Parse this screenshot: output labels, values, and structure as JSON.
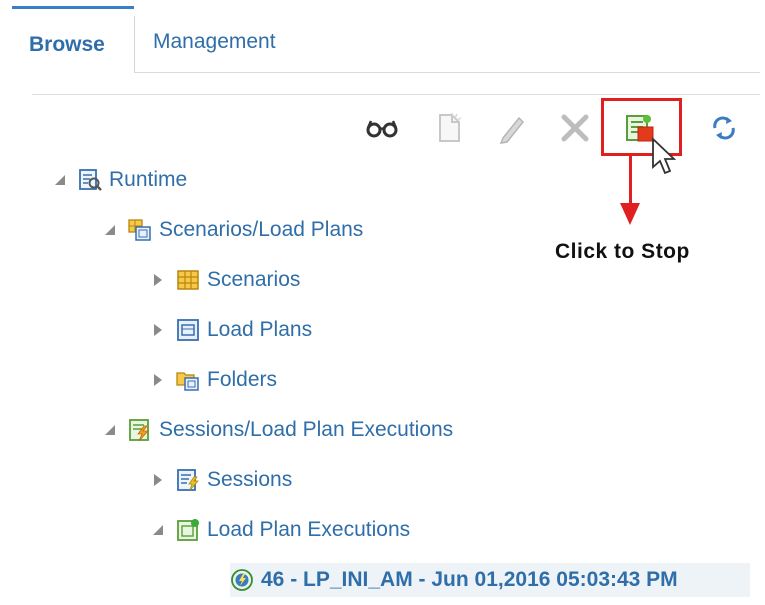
{
  "tabs": [
    {
      "label": "Browse",
      "active": true
    },
    {
      "label": "Management",
      "active": false
    }
  ],
  "toolbar": {
    "icons": [
      "view-icon",
      "new-icon",
      "edit-icon",
      "delete-icon",
      "stop-icon",
      "refresh-icon"
    ]
  },
  "callout": {
    "text": "Click to Stop",
    "color": "#e02020"
  },
  "tree": {
    "runtime": "Runtime",
    "scenarios_load_plans": "Scenarios/Load Plans",
    "scenarios": "Scenarios",
    "load_plans": "Load Plans",
    "folders": "Folders",
    "sessions_lp_executions": "Sessions/Load Plan Executions",
    "sessions": "Sessions",
    "load_plan_executions": "Load Plan Executions",
    "execution_item": "46 - LP_INI_AM - Jun 01,2016 05:03:43 PM"
  },
  "colors": {
    "link": "#2f6ea9",
    "tab_accent": "#3b7ec8",
    "selection_bg": "#eef3f8"
  }
}
